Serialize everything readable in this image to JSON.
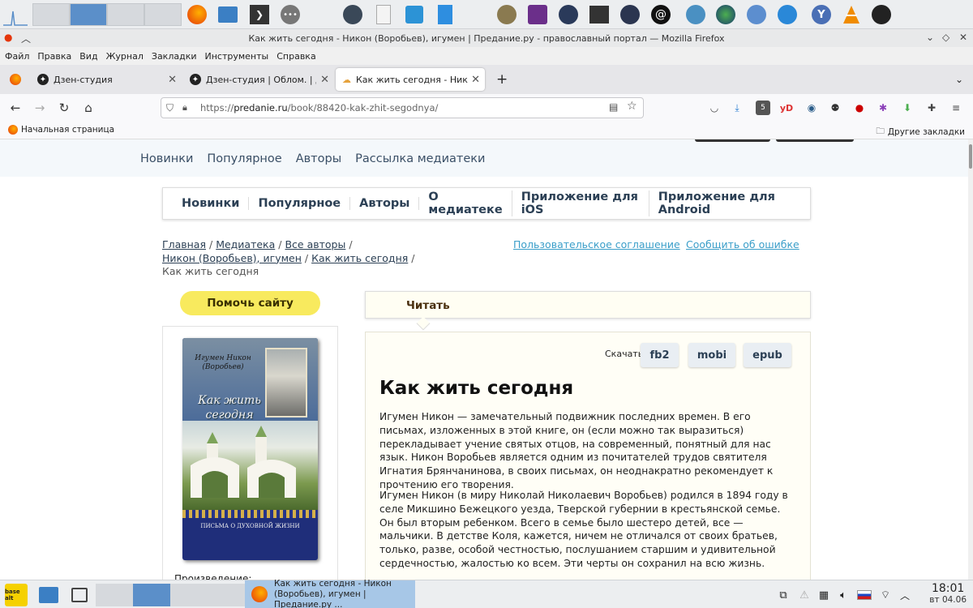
{
  "window": {
    "title": "Как жить сегодня - Никон (Воробьев), игумен | Предание.ру - православный портал — Mozilla Firefox"
  },
  "menu": [
    "Файл",
    "Правка",
    "Вид",
    "Журнал",
    "Закладки",
    "Инструменты",
    "Справка"
  ],
  "tabs": [
    {
      "label": "Дзен-студия",
      "active": false
    },
    {
      "label": "Дзен-студия | Облом. | Дзен",
      "active": false
    },
    {
      "label": "Как жить сегодня - Никон (Воробьев), игумен",
      "active": true
    }
  ],
  "urlbar": {
    "prefix": "https://",
    "domain": "predanie.ru",
    "path": "/book/88420-kak-zhit-segodnya/"
  },
  "bookmarks": {
    "left": "Начальная страница",
    "right": "Другие закладки"
  },
  "extensions": {
    "yd": "yD",
    "badge": "5"
  },
  "site": {
    "top_nav": [
      "Новинки",
      "Популярное",
      "Авторы",
      "Рассылка медиатеки"
    ],
    "main_nav": [
      "Новинки",
      "Популярное",
      "Авторы",
      "О медиатеке",
      "Приложение для iOS",
      "Приложение для Android"
    ],
    "breadcrumbs": {
      "home": "Главная",
      "library": "Медиатека",
      "authors": "Все авторы",
      "author": "Никон (Воробьев), игумен",
      "book": "Как жить сегодня",
      "current": "Как жить сегодня",
      "sep": "/"
    },
    "agreement_link": "Пользовательское соглашение",
    "report_link": "Сообщить об ошибке",
    "help_button": "Помочь сайту",
    "read_tab": "Читать",
    "download_label": "Скачать",
    "formats": [
      "fb2",
      "mobi",
      "epub"
    ],
    "book_title": "Как жить сегодня",
    "paragraphs": [
      "Игумен Никон — замечательный подвижник последних времен. В его письмах, изложенных в этой книге, он (если можно так выразиться) перекладывает учение святых отцов, на современный, понятный для нас язык. Никон Воробьев является одним из почитателей трудов святителя Игнатия Брянчанинова, в своих письмах, он неоднакратно рекомендует к прочтению его творения.",
      "Игумен Никон (в миру Николай Николаевич Воробьев) родился в 1894 году в селе Микшино Бежецкого уезда, Тверской губернии в крестьянской семье. Он был вторым ребенком. Всего в семье было шестеро детей, все — мальчики. В детстве Коля, кажется, ничем не отличался от своих братьев, только, разве, особой честностью, послушанием старшим и удивительной сердечностью, жалостью ко всем. Эти черты он сохранил на всю жизнь."
    ],
    "cover": {
      "author": "Игумен Никон (Воробьев)",
      "title": "Как жить сегодня",
      "subtitle": "ПИСЬМА О ДУХОВНОЙ ЖИЗНИ"
    },
    "cover_caption": "Произведение:"
  },
  "taskbar": {
    "active_window": "Как жить сегодня - Никон (Воробьев), игумен | Предание.ру ...",
    "time": "18:01",
    "date": "вт 04.06",
    "start_label": "base alt"
  },
  "colors": {
    "help_button": "#f8ea5e",
    "nav_text": "#2c4055",
    "link": "#3a9ec9",
    "active_thumb": "#5b8fc9"
  }
}
